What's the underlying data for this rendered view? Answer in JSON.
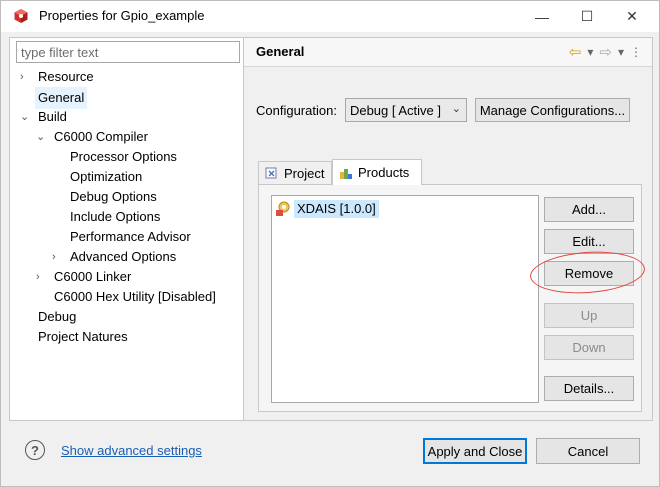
{
  "window": {
    "title": "Properties for Gpio_example",
    "controls": {
      "minimize": "—",
      "maximize": "☐",
      "close": "✕"
    }
  },
  "filter": {
    "placeholder": "type filter text",
    "value": ""
  },
  "tree": [
    {
      "label": "Resource",
      "toggle": "›",
      "expanded": false,
      "selected": false
    },
    {
      "label": "General",
      "toggle": "",
      "expanded": false,
      "selected": true
    },
    {
      "label": "Build",
      "toggle": "⌄",
      "expanded": true,
      "selected": false
    },
    {
      "label": "C6000 Compiler",
      "toggle": "⌄",
      "expanded": true,
      "selected": false
    },
    {
      "label": "Processor Options",
      "toggle": "",
      "selected": false
    },
    {
      "label": "Optimization",
      "toggle": "",
      "selected": false
    },
    {
      "label": "Debug Options",
      "toggle": "",
      "selected": false
    },
    {
      "label": "Include Options",
      "toggle": "",
      "selected": false
    },
    {
      "label": "Performance Advisor",
      "toggle": "",
      "selected": false
    },
    {
      "label": "Advanced Options",
      "toggle": "›",
      "expanded": false,
      "selected": false
    },
    {
      "label": "C6000 Linker",
      "toggle": "›",
      "expanded": false,
      "selected": false
    },
    {
      "label": "C6000 Hex Utility  [Disabled]",
      "toggle": "",
      "selected": false
    },
    {
      "label": "Debug",
      "toggle": "",
      "selected": false
    },
    {
      "label": "Project Natures",
      "toggle": "",
      "selected": false
    }
  ],
  "page": {
    "title": "General",
    "nav": {
      "back": "⇦",
      "back_menu": "▾",
      "forward": "⇨",
      "forward_menu": "▾",
      "more": "⋮"
    },
    "configuration": {
      "label": "Configuration:",
      "selected": "Debug  [ Active ]",
      "caret": "⌄",
      "manage_label": "Manage Configurations..."
    },
    "tabs": [
      {
        "label": "Project",
        "active": false
      },
      {
        "label": "Products",
        "active": true
      }
    ],
    "products": [
      {
        "name": "XDAIS  [1.0.0]",
        "selected": true
      }
    ],
    "buttons": {
      "add": "Add...",
      "edit": "Edit...",
      "remove": "Remove",
      "up": "Up",
      "down": "Down",
      "details": "Details..."
    }
  },
  "footer": {
    "help": "?",
    "advanced_link": "Show advanced settings",
    "apply_close": "Apply and Close",
    "cancel": "Cancel"
  },
  "colors": {
    "accent": "#0078d7",
    "link": "#1a5fb4",
    "selection": "#cce8ff",
    "annotation_ring": "#e0463f"
  }
}
